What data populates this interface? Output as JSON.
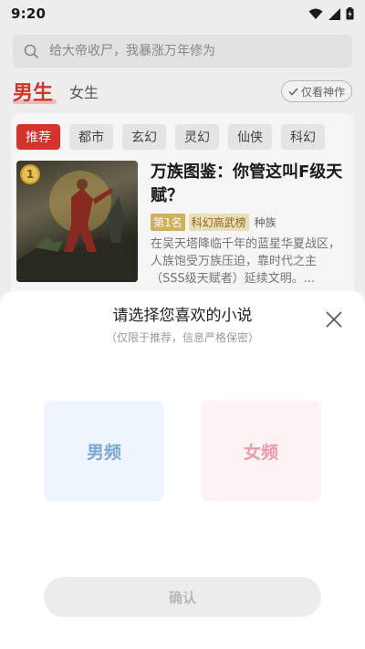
{
  "status": {
    "time": "9:20"
  },
  "search": {
    "placeholder": "给大帝收尸，我暴涨万年修为"
  },
  "gender_tabs": {
    "male": "男生",
    "female": "女生",
    "only_god_label": "仅看神作"
  },
  "categories": [
    "推荐",
    "都市",
    "玄幻",
    "灵幻",
    "仙侠",
    "科幻"
  ],
  "book": {
    "rank": "1",
    "title": "万族图鉴：你管这叫F级天赋？",
    "tag_rank": "第1名",
    "tag_list": "科幻高武榜",
    "genre": "种族",
    "description": "在吴天塔降临千年的蓝星华夏战区，人族饱受万族压迫，靠时代之主（SSS级天赋者）延续文明。..."
  },
  "sheet": {
    "title": "请选择您喜欢的小说",
    "subtitle": "（仅限于推荐，信息严格保密）",
    "male_option": "男频",
    "female_option": "女频",
    "confirm_label": "确认"
  },
  "colors": {
    "accent": "#d9342b",
    "male_option": "#7ea7d8",
    "female_option": "#ee9aa8"
  },
  "icons": [
    "wifi-icon",
    "signal-icon",
    "battery-icon",
    "search-icon",
    "check-icon",
    "close-icon"
  ]
}
